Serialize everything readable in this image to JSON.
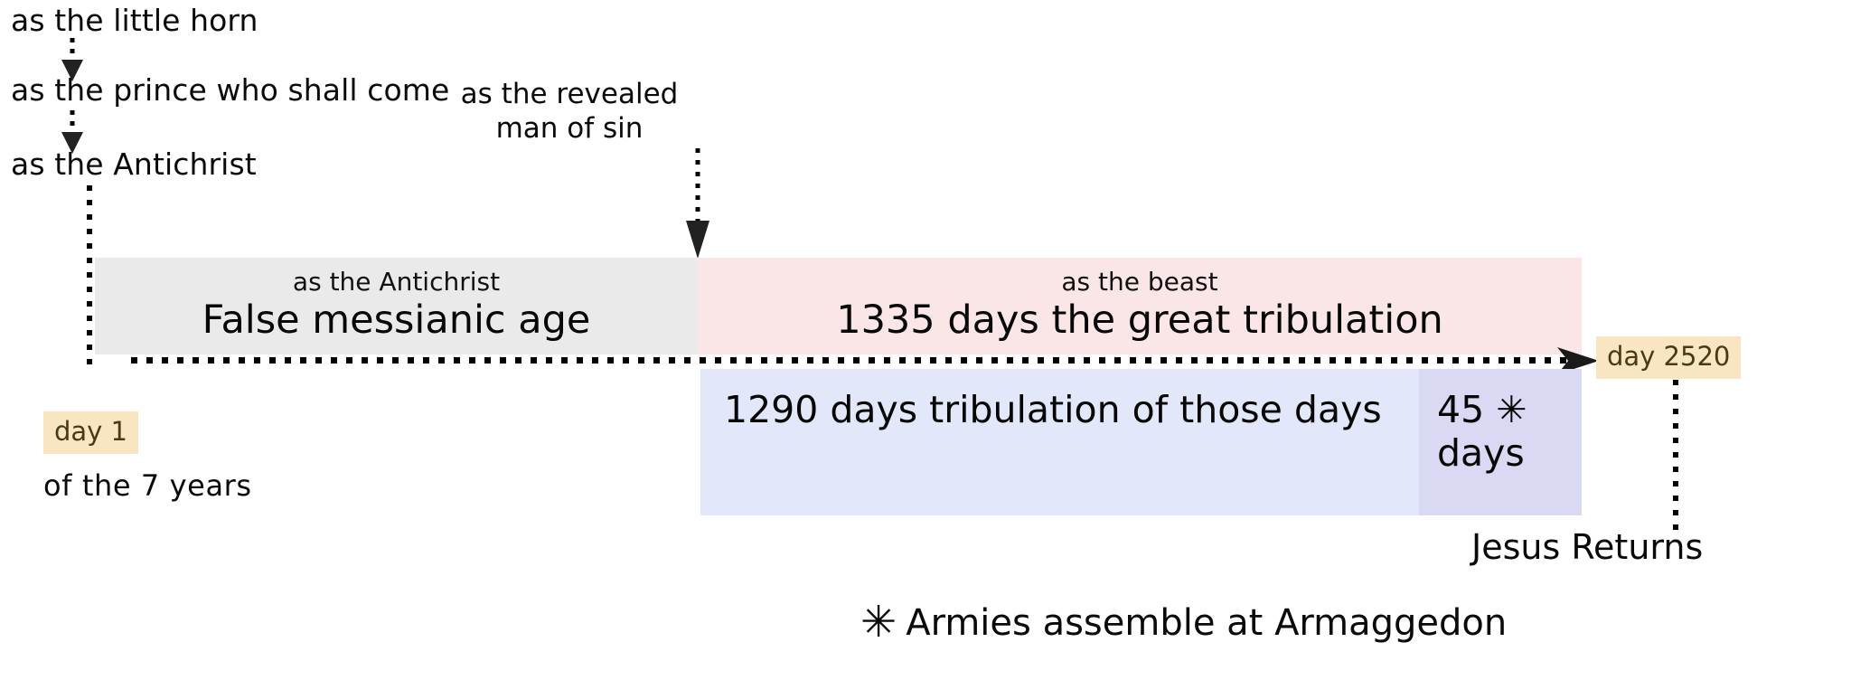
{
  "diagram": {
    "title_labels": [
      {
        "id": "little-horn",
        "text": "as the little horn"
      },
      {
        "id": "prince",
        "text": "as the prince who shall come"
      },
      {
        "id": "antichrist",
        "text": "as the Antichrist"
      }
    ],
    "center_note": {
      "line1": "as the revealed",
      "line2": "man of sin"
    },
    "bars": [
      {
        "id": "false-messianic-age",
        "small_label": "as the Antichrist",
        "big_label": "False messianic age",
        "color": "#eaeaea"
      },
      {
        "id": "great-tribulation",
        "small_label": "as the beast",
        "big_label": "1335 days the great tribulation",
        "color": "#fae6e6"
      }
    ],
    "lower_bars": [
      {
        "id": "tribulation-of-those-days",
        "text": "1290 days  tribulation of those days",
        "color": "#e2e7f9"
      },
      {
        "id": "forty-five-days",
        "line1": "45 ✳",
        "line2": "days",
        "color": "#d9d9f3"
      }
    ],
    "day_markers": [
      {
        "id": "day-1",
        "text": "day 1",
        "color": "#f9e5c1"
      },
      {
        "id": "day-2520",
        "text": "day 2520",
        "color": "#f9e5c1"
      }
    ],
    "captions": {
      "seven_years": "of the 7 years",
      "jesus_returns": "Jesus Returns"
    },
    "footnote": {
      "symbol": "✳",
      "text": "Armies assemble at Armaggedon"
    },
    "icons": {
      "down_arrow": "down-arrow-icon",
      "right_arrow": "right-arrow-icon"
    }
  }
}
